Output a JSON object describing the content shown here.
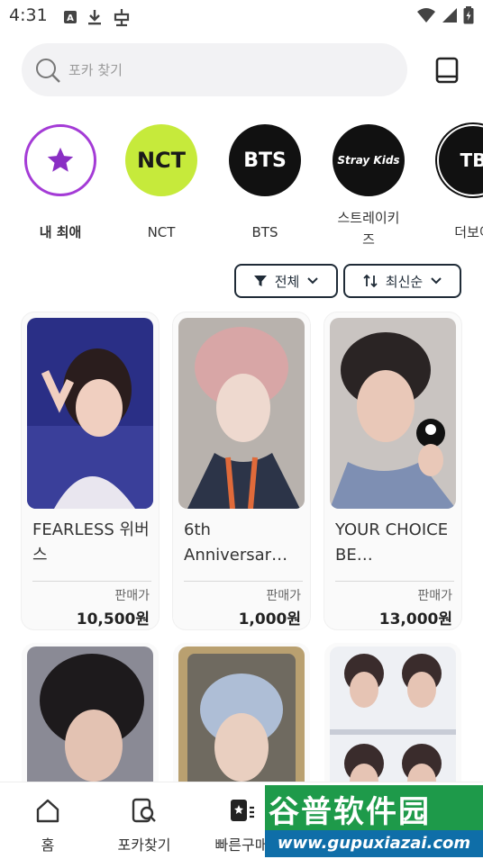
{
  "status": {
    "time": "4:31"
  },
  "search": {
    "placeholder": "포카 찾기"
  },
  "groups": [
    {
      "label": "내 최애",
      "logo": ""
    },
    {
      "label": "NCT",
      "logo": "NCT"
    },
    {
      "label": "BTS",
      "logo": "BTS"
    },
    {
      "label": "스트레이키\n즈",
      "logo": "Stray Kids"
    },
    {
      "label": "더보이",
      "logo": "TB"
    }
  ],
  "filters": {
    "all": "전체",
    "sort": "최신순"
  },
  "cards": [
    {
      "title": "FEARLESS 위버스",
      "price_label": "판매가",
      "price": "10,500원"
    },
    {
      "title": "6th Anniversar…",
      "price_label": "판매가",
      "price": "1,000원"
    },
    {
      "title": "YOUR CHOICE BE…",
      "price_label": "판매가",
      "price": "13,000원"
    }
  ],
  "nav": {
    "home": "홈",
    "search": "포카찾기",
    "quick": "빠른구매"
  },
  "watermark": {
    "title": "谷普软件园",
    "url": "www.gupuxiazai.com"
  },
  "colors": {
    "accent": "#1f2b37",
    "nct_green": "#c6ea3b",
    "fav_ring": "#a43bd6"
  }
}
